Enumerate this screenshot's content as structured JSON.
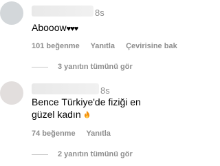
{
  "comments": [
    {
      "time": "8s",
      "text": "Abooow",
      "hearts": "♥♥♥",
      "likes": "101 beğenme",
      "reply": "Yanıtla",
      "translate": "Çevirisine bak",
      "view_replies": "3 yanıtın tümünü gör"
    },
    {
      "time": "8s",
      "text": "Bence Türkiye'de fiziği en güzel kadın",
      "emoji": "fire-icon",
      "likes": "74 beğenme",
      "reply": "Yanıtla",
      "view_replies": "2 yanıtın tümünü gör"
    }
  ]
}
